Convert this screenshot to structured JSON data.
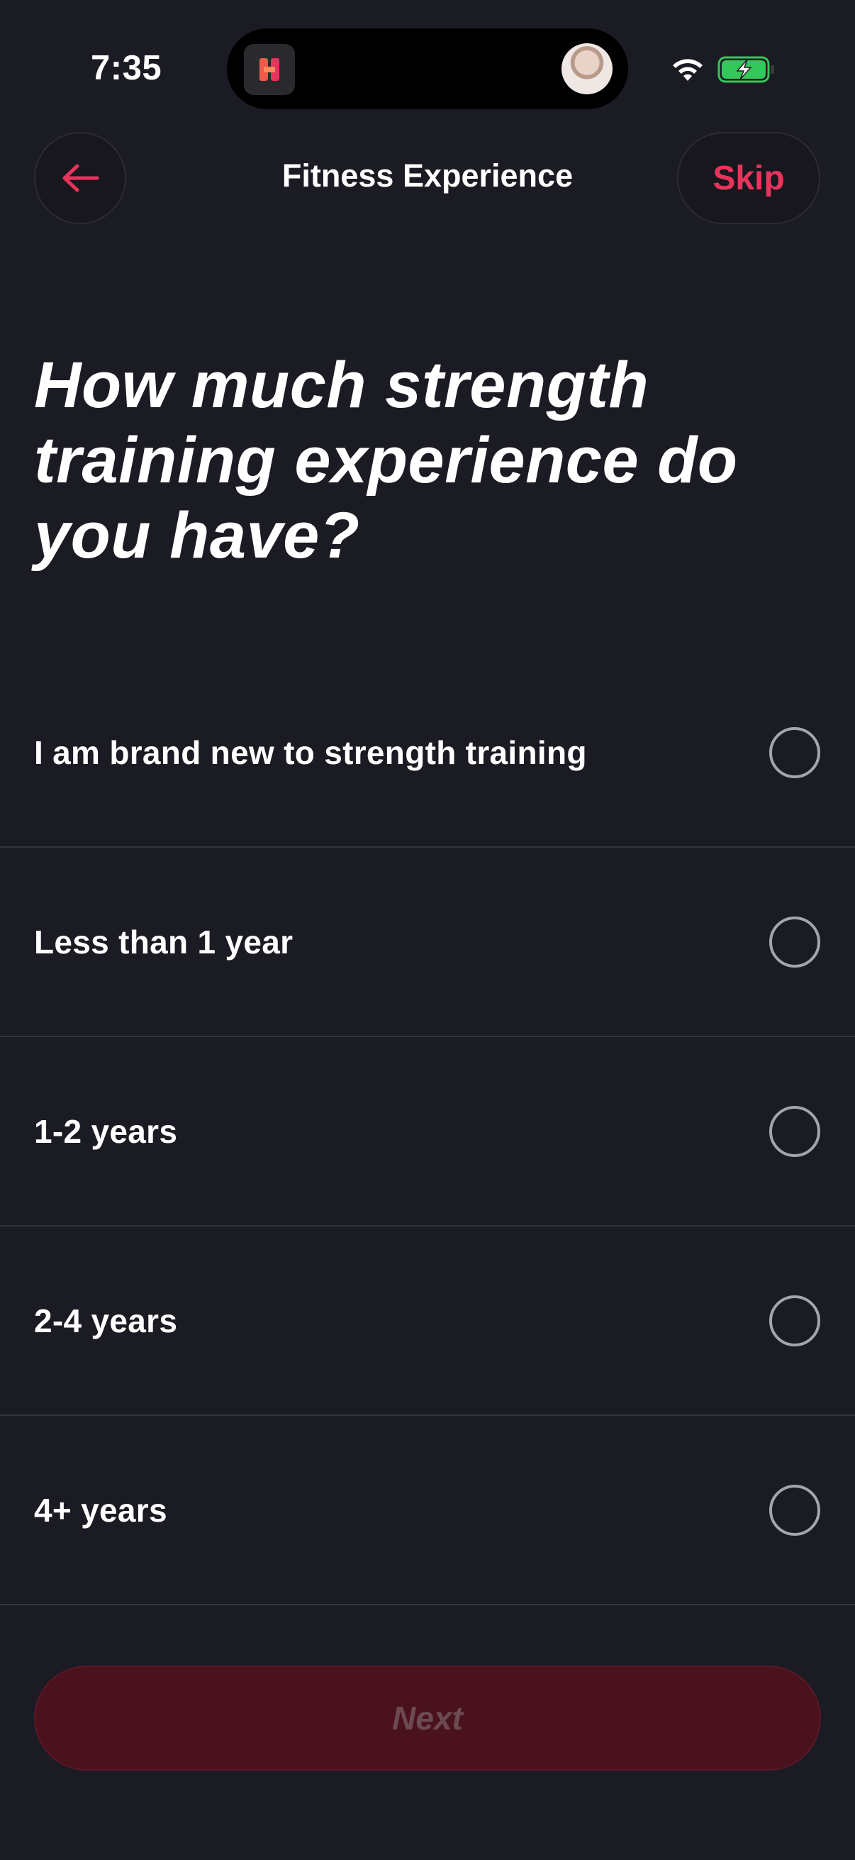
{
  "status_bar": {
    "time": "7:35"
  },
  "header": {
    "title": "Fitness Experience",
    "skip_label": "Skip"
  },
  "question": {
    "text": "How much strength training experience do you have?"
  },
  "options": [
    {
      "label": "I am brand new to strength training",
      "selected": false
    },
    {
      "label": "Less than 1 year",
      "selected": false
    },
    {
      "label": "1-2 years",
      "selected": false
    },
    {
      "label": "2-4 years",
      "selected": false
    },
    {
      "label": "4+ years",
      "selected": false
    }
  ],
  "footer": {
    "next_label": "Next",
    "next_enabled": false
  },
  "colors": {
    "background": "#1b1b24",
    "accent": "#e8345c",
    "next_disabled_bg": "#4a121d",
    "radio_border": "#a4a4ae"
  },
  "icons": {
    "back": "arrow-left-icon",
    "wifi": "wifi-icon",
    "battery": "battery-charging-icon",
    "app": "app-icon",
    "avatar": "avatar"
  }
}
